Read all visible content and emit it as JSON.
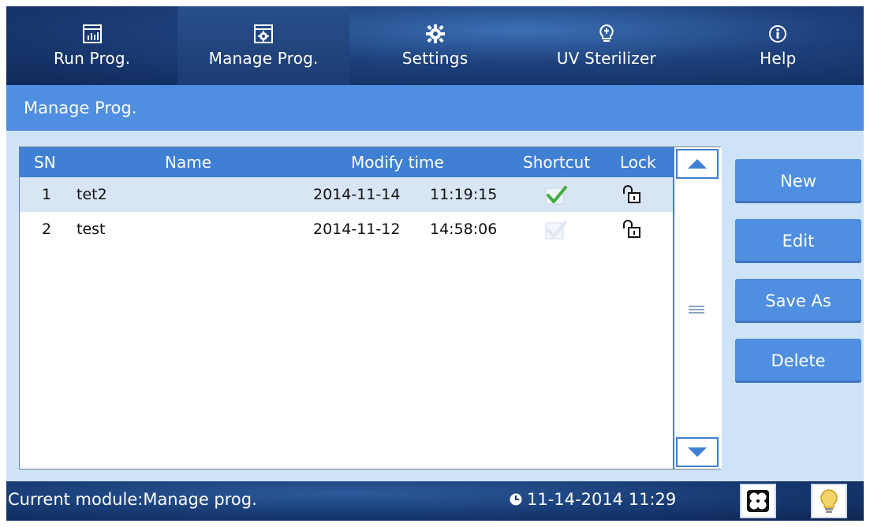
{
  "nav": {
    "tabs": [
      {
        "label": "Run Prog.",
        "icon": "chart-icon"
      },
      {
        "label": "Manage Prog.",
        "icon": "gear-box-icon"
      },
      {
        "label": "Settings",
        "icon": "gear-icon"
      },
      {
        "label": "UV Sterilizer",
        "icon": "uv-bulb-icon"
      },
      {
        "label": "Help",
        "icon": "info-icon"
      }
    ],
    "active_tab": "Manage Prog."
  },
  "page": {
    "title": "Manage Prog."
  },
  "table": {
    "columns": [
      "SN",
      "Name",
      "Modify time",
      "Shortcut",
      "Lock"
    ],
    "rows": [
      {
        "sn": "1",
        "name": "tet2",
        "date": "2014-11-14",
        "time": "11:19:15",
        "shortcut": true,
        "locked": false,
        "selected": true
      },
      {
        "sn": "2",
        "name": "test",
        "date": "2014-11-12",
        "time": "14:58:06",
        "shortcut": false,
        "locked": false,
        "selected": false
      }
    ]
  },
  "actions": {
    "new": "New",
    "edit": "Edit",
    "save_as": "Save As",
    "delete": "Delete"
  },
  "status": {
    "module_text": "Current module:Manage prog.",
    "datetime": "11-14-2014 11:29"
  },
  "colors": {
    "header_blue": "#3f7fd4",
    "title_blue": "#4f8ee0",
    "selected_row": "#d8e5f4",
    "check_green": "#3fae3f"
  }
}
